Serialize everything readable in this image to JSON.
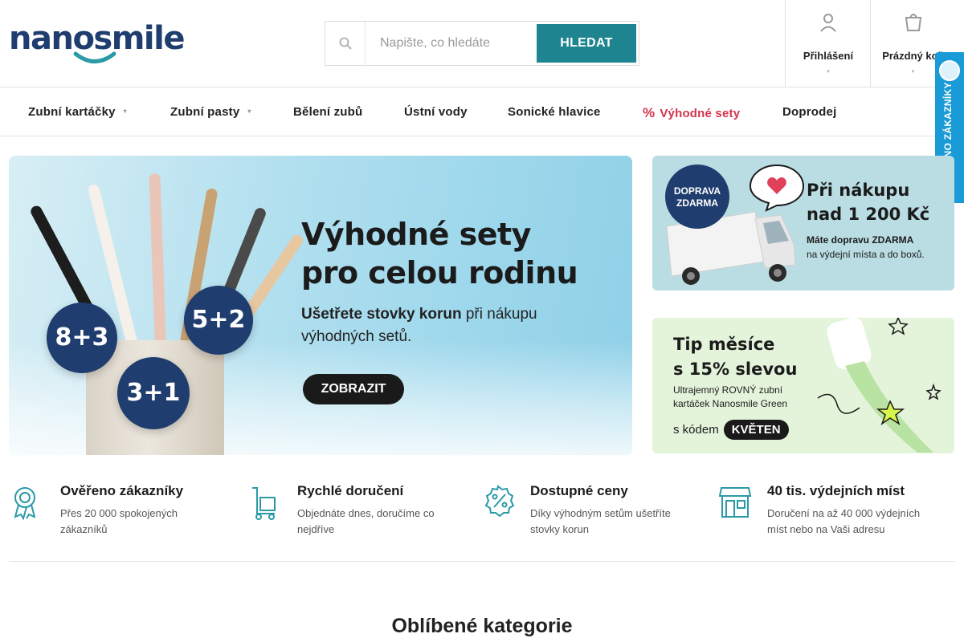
{
  "header": {
    "logo_text": "nanosmile",
    "search": {
      "placeholder": "Napište, co hledáte",
      "button_label": "HLEDAT"
    },
    "login_label": "Přihlášení",
    "cart_label": "Prázdný koš"
  },
  "nav": {
    "items": [
      {
        "label": "Zubní kartáčky",
        "has_caret": true
      },
      {
        "label": "Zubní pasty",
        "has_caret": true
      },
      {
        "label": "Bělení zubů"
      },
      {
        "label": "Ústní vody"
      },
      {
        "label": "Sonické hlavice"
      },
      {
        "label": "Výhodné sety",
        "icon": "%",
        "highlight": true
      },
      {
        "label": "Doprodej"
      }
    ]
  },
  "verified_badge": {
    "label": "OVĚŘENO ZÁKAZNÍKY"
  },
  "hero": {
    "title_line1": "Výhodné sety",
    "title_line2": "pro celou rodinu",
    "subtitle_bold": "Ušetřete stovky korun",
    "subtitle_rest": " při nákupu výhodných setů.",
    "cta_label": "ZOBRAZIT",
    "badges": [
      "8+3",
      "5+2",
      "3+1"
    ]
  },
  "promo_delivery": {
    "badge_line1": "DOPRAVA",
    "badge_line2": "ZDARMA",
    "title_line1": "Při nákupu",
    "title_line2": "nad 1 200 Kč",
    "text_bold": "Máte dopravu ZDARMA",
    "text_rest": "na výdejní místa a do boxů."
  },
  "promo_tip": {
    "title_line1": "Tip měsíce",
    "title_line2": "s 15% slevou",
    "text": "Ultrajemný ROVNÝ zubní kartáček Nanosmile Green",
    "code_prefix": "s kódem",
    "code": "KVĚTEN"
  },
  "benefits": [
    {
      "icon": "award-ribbon-icon",
      "title": "Ověřeno zákazníky",
      "text": "Přes 20 000 spokojených zákazníků"
    },
    {
      "icon": "delivery-cart-icon",
      "title": "Rychlé doručení",
      "text": "Objednáte dnes, doručíme co nejdříve"
    },
    {
      "icon": "percent-badge-icon",
      "title": "Dostupné ceny",
      "text": "Díky výhodným setům ušetříte stovky korun"
    },
    {
      "icon": "store-icon",
      "title": "40 tis. výdejních míst",
      "text": "Doručení na až 40 000 výdejních míst nebo na Vaši adresu"
    }
  ],
  "section_title": "Oblíbené kategorie",
  "colors": {
    "brand_teal": "#1e8590",
    "brand_navy": "#1f3d6e",
    "sale_red": "#d2344b",
    "badge_blue": "#1a9ad6"
  }
}
